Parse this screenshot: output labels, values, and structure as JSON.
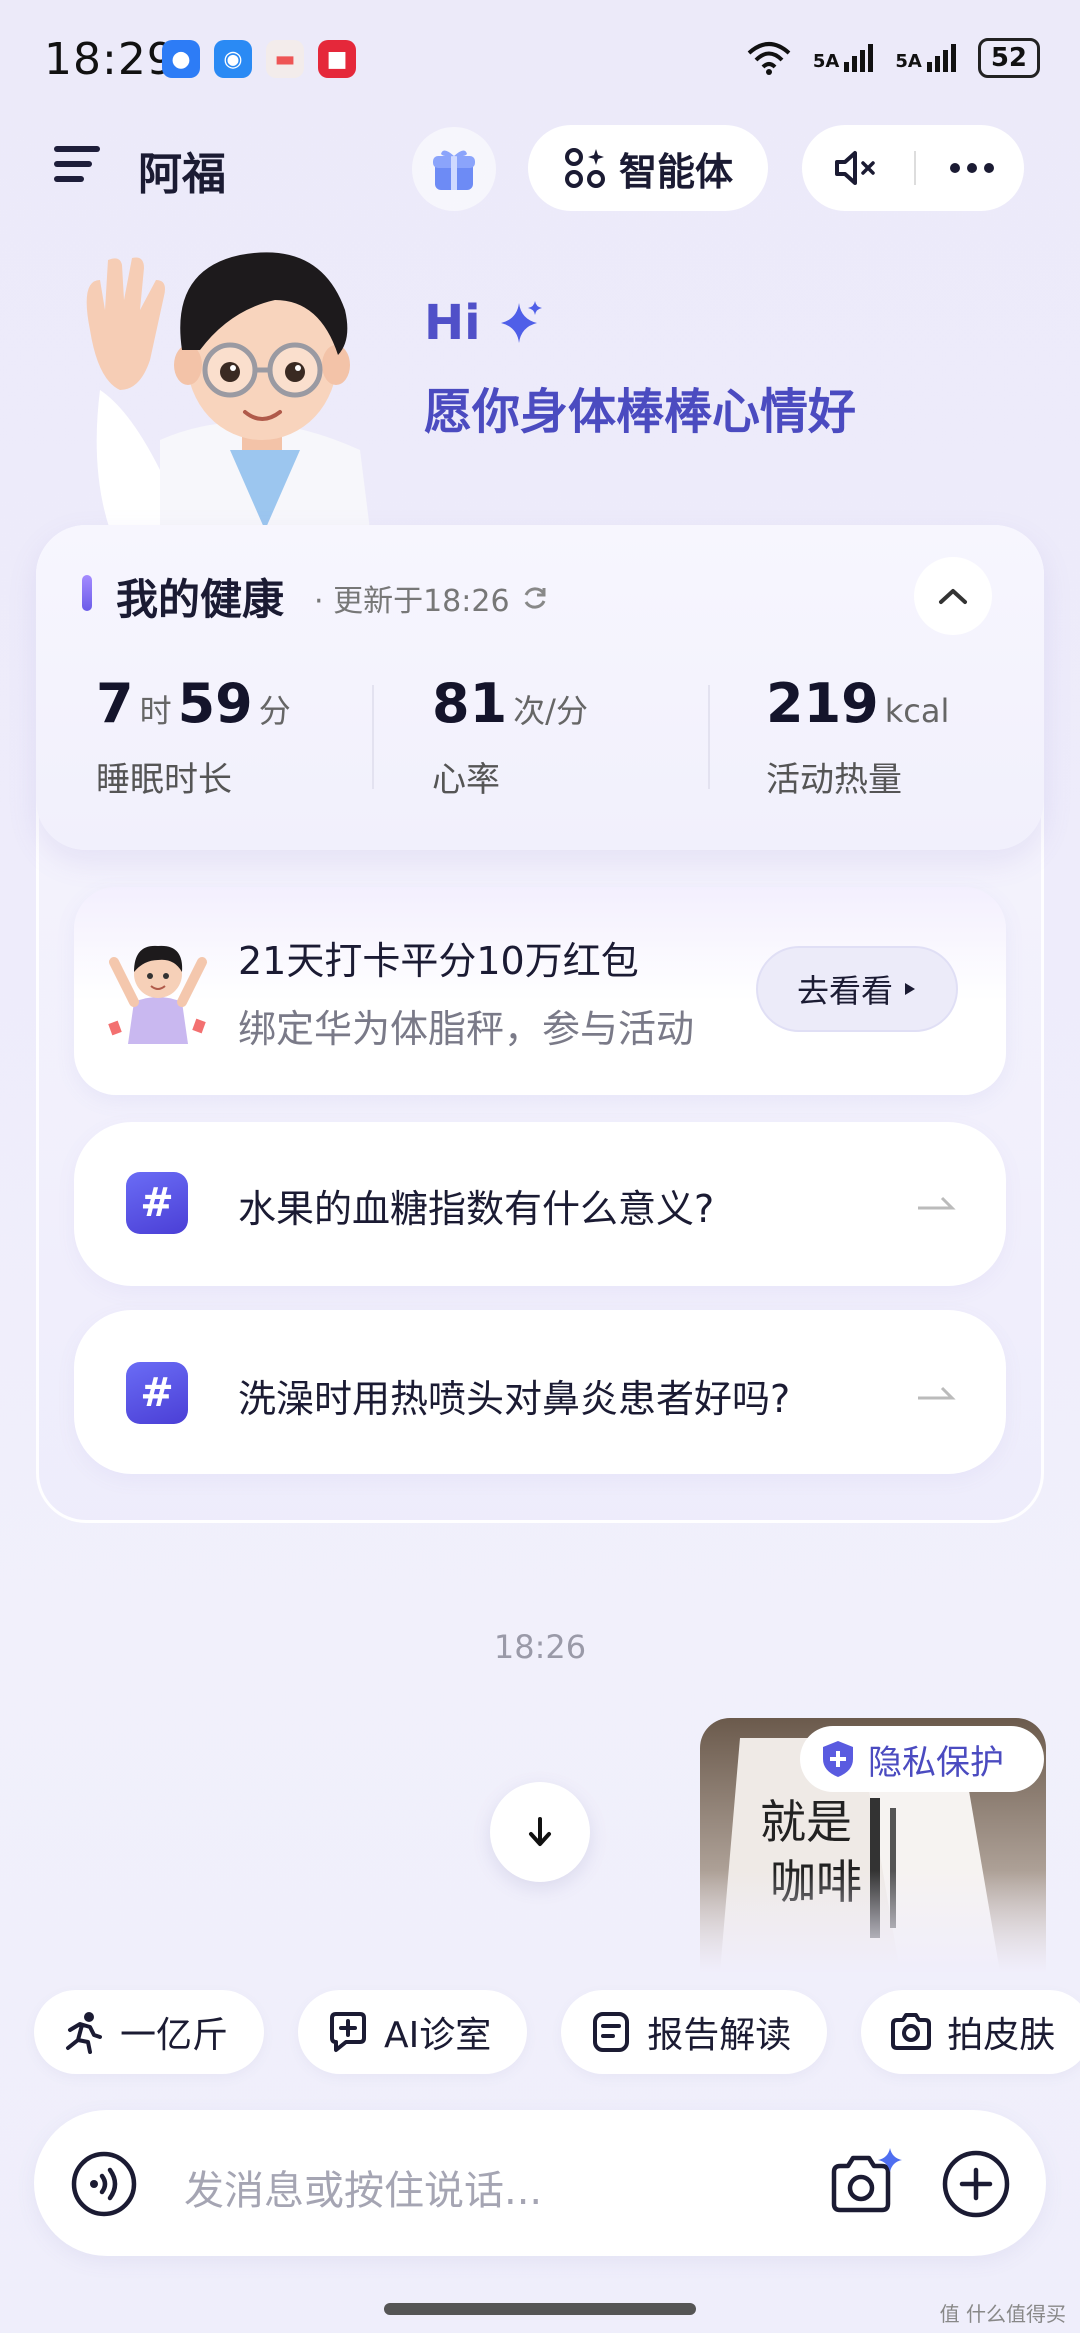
{
  "status_bar": {
    "time": "18:29",
    "signal1": "5A",
    "signal2": "5A",
    "battery": "52"
  },
  "header": {
    "title": "阿福",
    "agent_label": "智能体"
  },
  "greeting": {
    "hi": "Hi",
    "subtitle": "愿你身体棒棒心情好"
  },
  "health": {
    "title": "我的健康",
    "updated": "· 更新于18:26",
    "sleep": {
      "hours": "7",
      "hours_unit": "时",
      "minutes": "59",
      "minutes_unit": "分",
      "label": "睡眠时长"
    },
    "heart_rate": {
      "value": "81",
      "unit": "次/分",
      "label": "心率"
    },
    "calories": {
      "value": "219",
      "unit": "kcal",
      "label": "活动热量"
    }
  },
  "promo": {
    "title": "21天打卡平分10万红包",
    "subtitle": "绑定华为体脂秤，参与活动",
    "button": "去看看"
  },
  "questions": [
    {
      "text": "水果的血糖指数有什么意义?"
    },
    {
      "text": "洗澡时用热喷头对鼻炎患者好吗?"
    }
  ],
  "chat": {
    "time": "18:26",
    "privacy_label": "隐私保护"
  },
  "chips": [
    {
      "label": "一亿斤",
      "icon": "running-icon"
    },
    {
      "label": "AI诊室",
      "icon": "chat-plus-icon"
    },
    {
      "label": "报告解读",
      "icon": "report-icon"
    },
    {
      "label": "拍皮肤",
      "icon": "camera-icon"
    }
  ],
  "input": {
    "placeholder": "发消息或按住说话..."
  },
  "watermark": "值 什么值得买",
  "colors": {
    "accent": "#4b4bc0",
    "background": "#eceaf9",
    "hash_badge": "#5a52e6"
  }
}
